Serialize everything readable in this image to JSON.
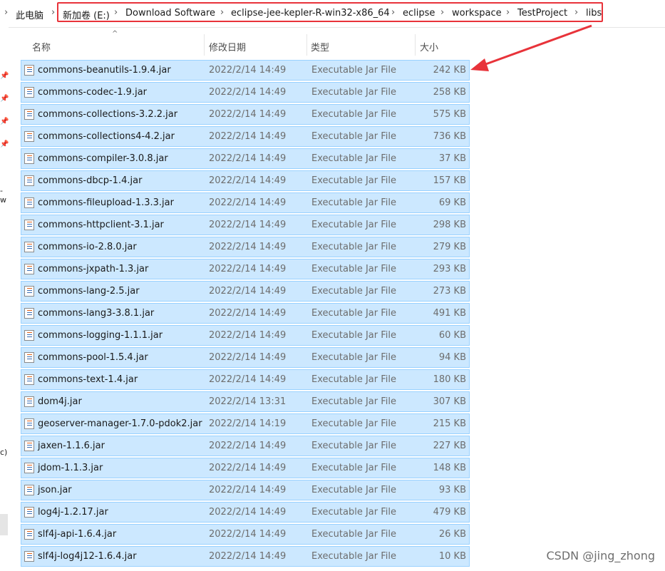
{
  "breadcrumb": {
    "items": [
      "此电脑",
      "新加卷 (E:)",
      "Download Software",
      "eclipse-jee-kepler-R-win32-x86_64",
      "eclipse",
      "workspace",
      "TestProject",
      "libs"
    ]
  },
  "sidebar": {
    "fragments": [
      "-w",
      "c)"
    ]
  },
  "columns": {
    "name": "名称",
    "date": "修改日期",
    "type": "类型",
    "size": "大小"
  },
  "files": [
    {
      "name": "commons-beanutils-1.9.4.jar",
      "date": "2022/2/14 14:49",
      "type": "Executable Jar File",
      "size": "242 KB"
    },
    {
      "name": "commons-codec-1.9.jar",
      "date": "2022/2/14 14:49",
      "type": "Executable Jar File",
      "size": "258 KB"
    },
    {
      "name": "commons-collections-3.2.2.jar",
      "date": "2022/2/14 14:49",
      "type": "Executable Jar File",
      "size": "575 KB"
    },
    {
      "name": "commons-collections4-4.2.jar",
      "date": "2022/2/14 14:49",
      "type": "Executable Jar File",
      "size": "736 KB"
    },
    {
      "name": "commons-compiler-3.0.8.jar",
      "date": "2022/2/14 14:49",
      "type": "Executable Jar File",
      "size": "37 KB"
    },
    {
      "name": "commons-dbcp-1.4.jar",
      "date": "2022/2/14 14:49",
      "type": "Executable Jar File",
      "size": "157 KB"
    },
    {
      "name": "commons-fileupload-1.3.3.jar",
      "date": "2022/2/14 14:49",
      "type": "Executable Jar File",
      "size": "69 KB"
    },
    {
      "name": "commons-httpclient-3.1.jar",
      "date": "2022/2/14 14:49",
      "type": "Executable Jar File",
      "size": "298 KB"
    },
    {
      "name": "commons-io-2.8.0.jar",
      "date": "2022/2/14 14:49",
      "type": "Executable Jar File",
      "size": "279 KB"
    },
    {
      "name": "commons-jxpath-1.3.jar",
      "date": "2022/2/14 14:49",
      "type": "Executable Jar File",
      "size": "293 KB"
    },
    {
      "name": "commons-lang-2.5.jar",
      "date": "2022/2/14 14:49",
      "type": "Executable Jar File",
      "size": "273 KB"
    },
    {
      "name": "commons-lang3-3.8.1.jar",
      "date": "2022/2/14 14:49",
      "type": "Executable Jar File",
      "size": "491 KB"
    },
    {
      "name": "commons-logging-1.1.1.jar",
      "date": "2022/2/14 14:49",
      "type": "Executable Jar File",
      "size": "60 KB"
    },
    {
      "name": "commons-pool-1.5.4.jar",
      "date": "2022/2/14 14:49",
      "type": "Executable Jar File",
      "size": "94 KB"
    },
    {
      "name": "commons-text-1.4.jar",
      "date": "2022/2/14 14:49",
      "type": "Executable Jar File",
      "size": "180 KB"
    },
    {
      "name": "dom4j.jar",
      "date": "2022/2/14 13:31",
      "type": "Executable Jar File",
      "size": "307 KB"
    },
    {
      "name": "geoserver-manager-1.7.0-pdok2.jar",
      "date": "2022/2/14 14:19",
      "type": "Executable Jar File",
      "size": "215 KB"
    },
    {
      "name": "jaxen-1.1.6.jar",
      "date": "2022/2/14 14:49",
      "type": "Executable Jar File",
      "size": "227 KB"
    },
    {
      "name": "jdom-1.1.3.jar",
      "date": "2022/2/14 14:49",
      "type": "Executable Jar File",
      "size": "148 KB"
    },
    {
      "name": "json.jar",
      "date": "2022/2/14 14:49",
      "type": "Executable Jar File",
      "size": "93 KB"
    },
    {
      "name": "log4j-1.2.17.jar",
      "date": "2022/2/14 14:49",
      "type": "Executable Jar File",
      "size": "479 KB"
    },
    {
      "name": "slf4j-api-1.6.4.jar",
      "date": "2022/2/14 14:49",
      "type": "Executable Jar File",
      "size": "26 KB"
    },
    {
      "name": "slf4j-log4j12-1.6.4.jar",
      "date": "2022/2/14 14:49",
      "type": "Executable Jar File",
      "size": "10 KB"
    }
  ],
  "watermark": "CSDN @jing_zhong",
  "colors": {
    "selection": "#cce8ff",
    "selection_border": "#99d1ff",
    "annotation_red": "#e8333a"
  }
}
